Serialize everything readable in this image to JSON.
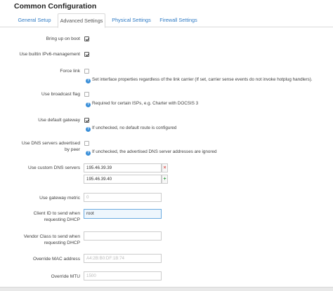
{
  "page": {
    "title": "Common Configuration"
  },
  "tabs": [
    {
      "label": "General Setup"
    },
    {
      "label": "Advanced Settings",
      "active": true
    },
    {
      "label": "Physical Settings"
    },
    {
      "label": "Firewall Settings"
    }
  ],
  "fields": {
    "bring_up": {
      "label": "Bring up on boot",
      "checked": true
    },
    "ipv6": {
      "label": "Use builtin IPv6-management",
      "checked": true
    },
    "force_link": {
      "label": "Force link",
      "checked": false,
      "hint": "Set interface properties regardless of the link carrier (If set, carrier sense events do not invoke hotplug handlers)."
    },
    "broadcast": {
      "label": "Use broadcast flag",
      "checked": false,
      "hint": "Required for certain ISPs, e.g. Charter with DOCSIS 3"
    },
    "default_gw": {
      "label": "Use default gateway",
      "checked": true,
      "hint": "If unchecked, no default route is configured"
    },
    "peer_dns": {
      "label_line1": "Use DNS servers advertised",
      "label_line2": "by peer",
      "checked": false,
      "hint": "If unchecked, the advertised DNS server addresses are ignored"
    },
    "custom_dns": {
      "label": "Use custom DNS servers",
      "values": [
        "195.46.39.39",
        "195.46.39.40"
      ],
      "remove_label": "×",
      "add_label": "+"
    },
    "gw_metric": {
      "label": "Use gateway metric",
      "placeholder": "0"
    },
    "client_id": {
      "label_line1": "Client ID to send when",
      "label_line2": "requesting DHCP",
      "value": "root"
    },
    "vendor_class": {
      "label_line1": "Vendor Class to send when",
      "label_line2": "requesting DHCP",
      "value": ""
    },
    "mac": {
      "label": "Override MAC address",
      "placeholder": "A4:2B:B0:DF:1B:74"
    },
    "mtu": {
      "label": "Override MTU",
      "placeholder": "1500"
    }
  },
  "icons": {
    "help": "help-icon",
    "help_glyph": "?"
  },
  "colors": {
    "link": "#2f7bc5",
    "help": "#3a8fd9",
    "remove": "#d9534f",
    "add": "#3aa24a",
    "focus_bg": "#eef6fd"
  }
}
